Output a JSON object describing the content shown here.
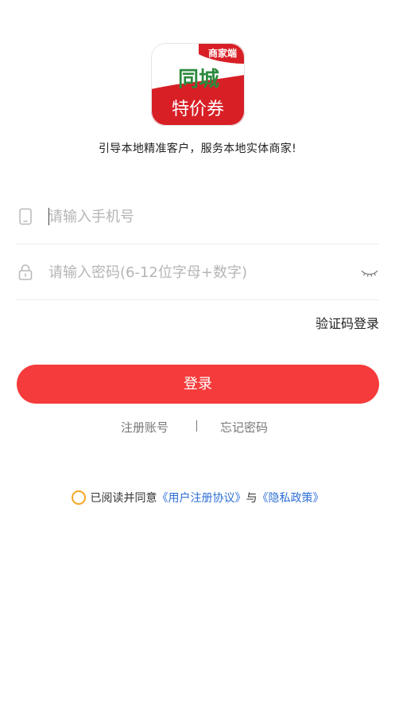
{
  "app": {
    "logo_badge": "商家端",
    "logo_line1": "同城",
    "logo_line2": "特价券",
    "slogan": "引导本地精准客户，服务本地实体商家!"
  },
  "form": {
    "phone_placeholder": "请输入手机号",
    "password_placeholder": "请输入密码(6-12位字母+数字)",
    "code_login_label": "验证码登录",
    "login_button": "登录"
  },
  "links": {
    "register": "注册账号",
    "forgot": "忘记密码"
  },
  "agreement": {
    "prefix": "已阅读并同意",
    "user_agreement": "《用户注册协议》",
    "conjunction": "与",
    "privacy_policy": "《隐私政策》"
  },
  "icons": {
    "phone": "phone-icon",
    "lock": "lock-icon",
    "password_visibility": "eye-closed-icon",
    "agree": "radio-unchecked-icon"
  },
  "colors": {
    "primary_red": "#f53b3b",
    "link_blue": "#2f6fd6",
    "radio_orange": "#f5a623"
  }
}
